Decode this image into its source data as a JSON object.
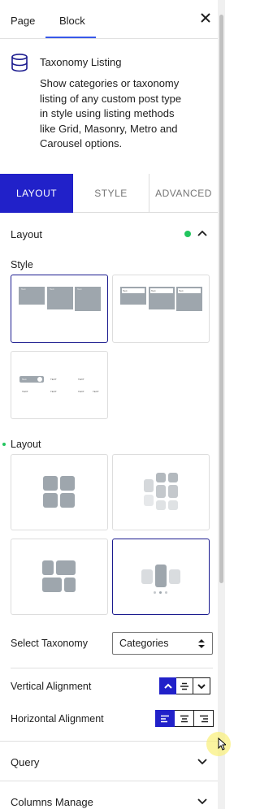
{
  "header": {
    "tab_page": "Page",
    "tab_block": "Block",
    "close_icon": "close-icon"
  },
  "block_info": {
    "icon": "database-icon",
    "title": "Taxonomy Listing",
    "description": "Show categories or taxonomy listing of any custom post type in style using listing methods like Grid, Masonry, Metro and Carousel options."
  },
  "tabs": [
    "LAYOUT",
    "STYLE",
    "ADVANCED"
  ],
  "layout_panel": {
    "title": "Layout",
    "style_label": "Style",
    "layout_label": "Layout",
    "select_taxonomy_label": "Select Taxonomy",
    "select_taxonomy_value": "Categories",
    "vertical_alignment_label": "Vertical Alignment",
    "horizontal_alignment_label": "Horizontal Alignment",
    "status_color": "#22c55e",
    "accent_color": "#2121c9"
  },
  "style_thumbs": {
    "t1": [
      "Text",
      "Text",
      "Text"
    ],
    "t2": [
      "Text",
      "Text",
      "Text"
    ],
    "t3_row1": [
      "Text",
      "TEXT",
      "TEXT"
    ],
    "t3_row2": [
      "TEXT",
      "TEXT",
      "TEXT",
      "TEXT"
    ]
  },
  "sections": {
    "query": "Query",
    "columns_manage": "Columns Manage"
  }
}
